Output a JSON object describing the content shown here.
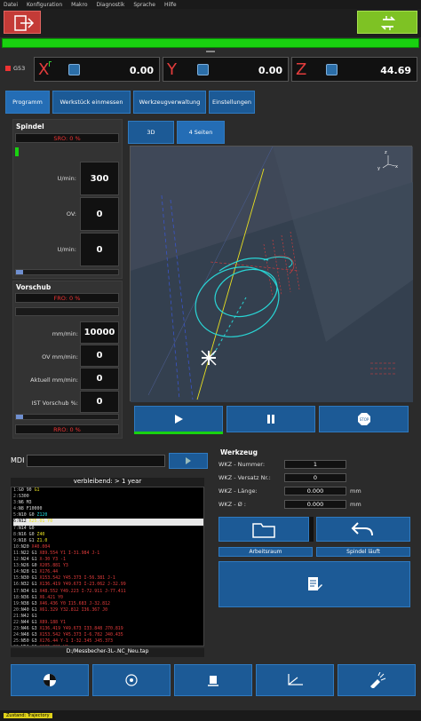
{
  "menu": [
    "Datei",
    "Konfiguration",
    "Makro",
    "Diagnostik",
    "Sprache",
    "Hilfe"
  ],
  "status_code": "G53",
  "axes": [
    {
      "letter": "X",
      "value": "0.00",
      "color": "#e33c3c"
    },
    {
      "letter": "Y",
      "value": "0.00",
      "color": "#e33c3c"
    },
    {
      "letter": "Z",
      "value": "44.69",
      "color": "#e33c3c"
    }
  ],
  "tabs": [
    "Programm",
    "Werkstück einmessen",
    "Werkzeugverwaltung",
    "Einstellungen"
  ],
  "spindel": {
    "title": "Spindel",
    "override": "SRO: 0 %",
    "rows": [
      {
        "label": "U/min:",
        "value": "300"
      },
      {
        "label": "OV:",
        "value": "0"
      },
      {
        "label": "U/min:",
        "value": "0"
      }
    ]
  },
  "vorschub": {
    "title": "Vorschub",
    "override": "FRO: 0 %",
    "rows": [
      {
        "label": "mm/min:",
        "value": "10000"
      },
      {
        "label": "OV mm/min:",
        "value": "0"
      },
      {
        "label": "Aktuell mm/min:",
        "value": "0"
      },
      {
        "label": "IST Vorschub %:",
        "value": "0"
      }
    ],
    "rro": "RRO: 0 %"
  },
  "view_buttons": [
    "3D",
    "4 Seiten"
  ],
  "controls": {
    "stop_label": "STOP"
  },
  "mdi": {
    "label": "MDI"
  },
  "program": {
    "remaining": "verbleibend: > 1 year",
    "lines": [
      {
        "n": "1:",
        "t": "G0 90 ",
        "c": "G1",
        "col": "#e8e020"
      },
      {
        "n": "2:",
        "t": "S300",
        "c": "",
        "col": "#22e0e0"
      },
      {
        "n": "3:",
        "t": "N6 M3",
        "c": "",
        "col": "#22e0e0"
      },
      {
        "n": "4:",
        "t": "N8 F10000",
        "c": "",
        "col": "#e8e020"
      },
      {
        "n": "5:",
        "t": "N10 G0 ",
        "c": "Z120",
        "col": "#22e0e0"
      },
      {
        "n": "6:",
        "t": "N12 ",
        "c": "X25.01 Y0",
        "col": "#e8e020"
      },
      {
        "n": "7:",
        "t": "N14 G0",
        "c": "",
        "col": "#e8e020"
      },
      {
        "n": "8:",
        "t": "N16 G0 ",
        "c": "Z40",
        "col": "#e8e020"
      },
      {
        "n": "9:",
        "t": "N18 G1 ",
        "c": "Z1.0",
        "col": "#e8e020"
      },
      {
        "n": "10:",
        "t": "N20 ",
        "c": "X40.004",
        "col": "#e33c3c"
      },
      {
        "n": "11:",
        "t": "N22 G1 ",
        "c": "X89.554 Y1 I-31.984 J-1",
        "col": "#e33c3c"
      },
      {
        "n": "12:",
        "t": "N24 G1 ",
        "c": "X-30 Y3 -1",
        "col": "#e33c3c"
      },
      {
        "n": "13:",
        "t": "N26 G0 ",
        "c": "X205.881 Y3",
        "col": "#e33c3c"
      },
      {
        "n": "14:",
        "t": "N28 G1 ",
        "c": "X176.44",
        "col": "#e33c3c"
      },
      {
        "n": "15:",
        "t": "N30 G1 ",
        "c": "X153.542 Y45.373 I-56.381 J-1",
        "col": "#e33c3c"
      },
      {
        "n": "16:",
        "t": "N32 G1 ",
        "c": "X136.419 Y49.673 I-23.062 J-32.99",
        "col": "#e33c3c"
      },
      {
        "n": "17:",
        "t": "N34 G1 ",
        "c": "X48.552 Y49.223 I-72.911 J-77.411",
        "col": "#e33c3c"
      },
      {
        "n": "18:",
        "t": "N36 G1 ",
        "c": "X6.421 Y0",
        "col": "#e33c3c"
      },
      {
        "n": "19:",
        "t": "N38 G3 ",
        "c": "X46.436 Y0 I15.683 J-32.812",
        "col": "#e33c3c"
      },
      {
        "n": "20:",
        "t": "N40 G1 ",
        "c": "X61.329 Y32.812 I36.367 J0",
        "col": "#e33c3c"
      },
      {
        "n": "21:",
        "t": "N42 G1",
        "c": "",
        "col": "#e33c3c"
      },
      {
        "n": "22:",
        "t": "N44 G1 ",
        "c": "X89.188 Y1",
        "col": "#e33c3c"
      },
      {
        "n": "23:",
        "t": "N46 G3 ",
        "c": "X136.419 Y49.673 I33.848 J70.819",
        "col": "#e33c3c"
      },
      {
        "n": "24:",
        "t": "N48 G3 ",
        "c": "X153.542 Y45.373 I-6.782 J40.435",
        "col": "#e33c3c"
      },
      {
        "n": "25:",
        "t": "N50 G3 ",
        "c": "X176.44 Y-1 I-32.345 J45.373",
        "col": "#e33c3c"
      },
      {
        "n": "26:",
        "t": "N52 G1 ",
        "c": "X205.881 Y3",
        "col": "#e33c3c"
      },
      {
        "n": "27:",
        "t": "N54 G0 ",
        "c": "F14000",
        "col": "#22e0e0"
      },
      {
        "n": "28:",
        "t": "N56 G1 ",
        "c": "X134.276 Y1.408",
        "col": "#e33c3c"
      },
      {
        "n": "29:",
        "t": "N58 G1 ",
        "c": "",
        "col": "#e33c3c"
      }
    ],
    "filename": "D:/Messbecher-3L-.NC_Neu.tap"
  },
  "werkzeug": {
    "title": "Werkzeug",
    "rows": [
      {
        "label": "WKZ - Nummer:",
        "value": "1",
        "unit": ""
      },
      {
        "label": "WKZ - Versatz Nr.:",
        "value": "0",
        "unit": ""
      },
      {
        "label": "WKZ - Länge:",
        "value": "0.000",
        "unit": "mm"
      },
      {
        "label": "WKZ - Ø :",
        "value": "0.000",
        "unit": "mm"
      }
    ]
  },
  "buttons": {
    "arbeitsraum": "Arbeitsraum",
    "spindel_lauft": "Spindel läuft"
  },
  "statusbar": {
    "badge": "Zustand: Trajectory"
  }
}
